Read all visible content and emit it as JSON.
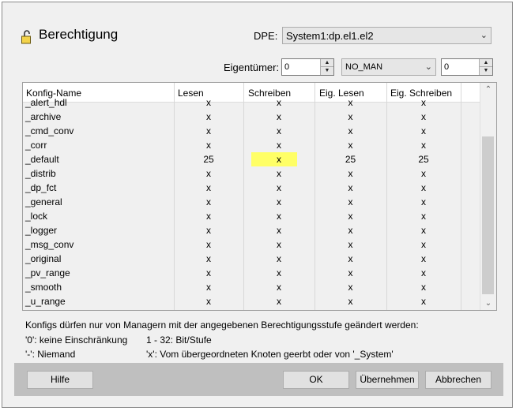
{
  "title": "Berechtigung",
  "dpe": {
    "label": "DPE:",
    "value": "System1:dp.el1.el2"
  },
  "owner": {
    "label": "Eigentümer:",
    "level": "0",
    "manager": "NO_MAN",
    "manager_level": "0"
  },
  "table": {
    "columns": [
      "Konfig-Name",
      "Lesen",
      "Schreiben",
      "Eig. Lesen",
      "Eig. Schreiben"
    ],
    "rows": [
      {
        "name": "_alert_hdl",
        "lesen": "x",
        "schreiben": "x",
        "eig_lesen": "x",
        "eig_schreiben": "x"
      },
      {
        "name": "_archive",
        "lesen": "x",
        "schreiben": "x",
        "eig_lesen": "x",
        "eig_schreiben": "x"
      },
      {
        "name": "_cmd_conv",
        "lesen": "x",
        "schreiben": "x",
        "eig_lesen": "x",
        "eig_schreiben": "x"
      },
      {
        "name": "_corr",
        "lesen": "x",
        "schreiben": "x",
        "eig_lesen": "x",
        "eig_schreiben": "x"
      },
      {
        "name": "_default",
        "lesen": "25",
        "schreiben": "x",
        "eig_lesen": "25",
        "eig_schreiben": "25"
      },
      {
        "name": "_distrib",
        "lesen": "x",
        "schreiben": "x",
        "eig_lesen": "x",
        "eig_schreiben": "x"
      },
      {
        "name": "_dp_fct",
        "lesen": "x",
        "schreiben": "x",
        "eig_lesen": "x",
        "eig_schreiben": "x"
      },
      {
        "name": "_general",
        "lesen": "x",
        "schreiben": "x",
        "eig_lesen": "x",
        "eig_schreiben": "x"
      },
      {
        "name": "_lock",
        "lesen": "x",
        "schreiben": "x",
        "eig_lesen": "x",
        "eig_schreiben": "x"
      },
      {
        "name": "_logger",
        "lesen": "x",
        "schreiben": "x",
        "eig_lesen": "x",
        "eig_schreiben": "x"
      },
      {
        "name": "_msg_conv",
        "lesen": "x",
        "schreiben": "x",
        "eig_lesen": "x",
        "eig_schreiben": "x"
      },
      {
        "name": "_original",
        "lesen": "x",
        "schreiben": "x",
        "eig_lesen": "x",
        "eig_schreiben": "x"
      },
      {
        "name": "_pv_range",
        "lesen": "x",
        "schreiben": "x",
        "eig_lesen": "x",
        "eig_schreiben": "x"
      },
      {
        "name": "_smooth",
        "lesen": "x",
        "schreiben": "x",
        "eig_lesen": "x",
        "eig_schreiben": "x"
      },
      {
        "name": "_u_range",
        "lesen": "x",
        "schreiben": "x",
        "eig_lesen": "x",
        "eig_schreiben": "x"
      }
    ],
    "highlight_color": "#ffff66"
  },
  "notes": {
    "line1": "Konfigs dürfen nur von Managern mit der angegebenen Berechtigungsstufe geändert werden:",
    "zero": "'0': keine Einschränkung",
    "range": "1 - 32: Bit/Stufe",
    "dash": "'-': Niemand",
    "x": "'x': Vom übergeordneten Knoten geerbt oder von '_System'"
  },
  "buttons": {
    "help": "Hilfe",
    "ok": "OK",
    "apply": "Übernehmen",
    "cancel": "Abbrechen"
  },
  "icons": {
    "title": "lock-icon",
    "dropdown": "chevron-down-icon",
    "spin_up": "spin-up-icon",
    "spin_down": "spin-down-icon"
  }
}
